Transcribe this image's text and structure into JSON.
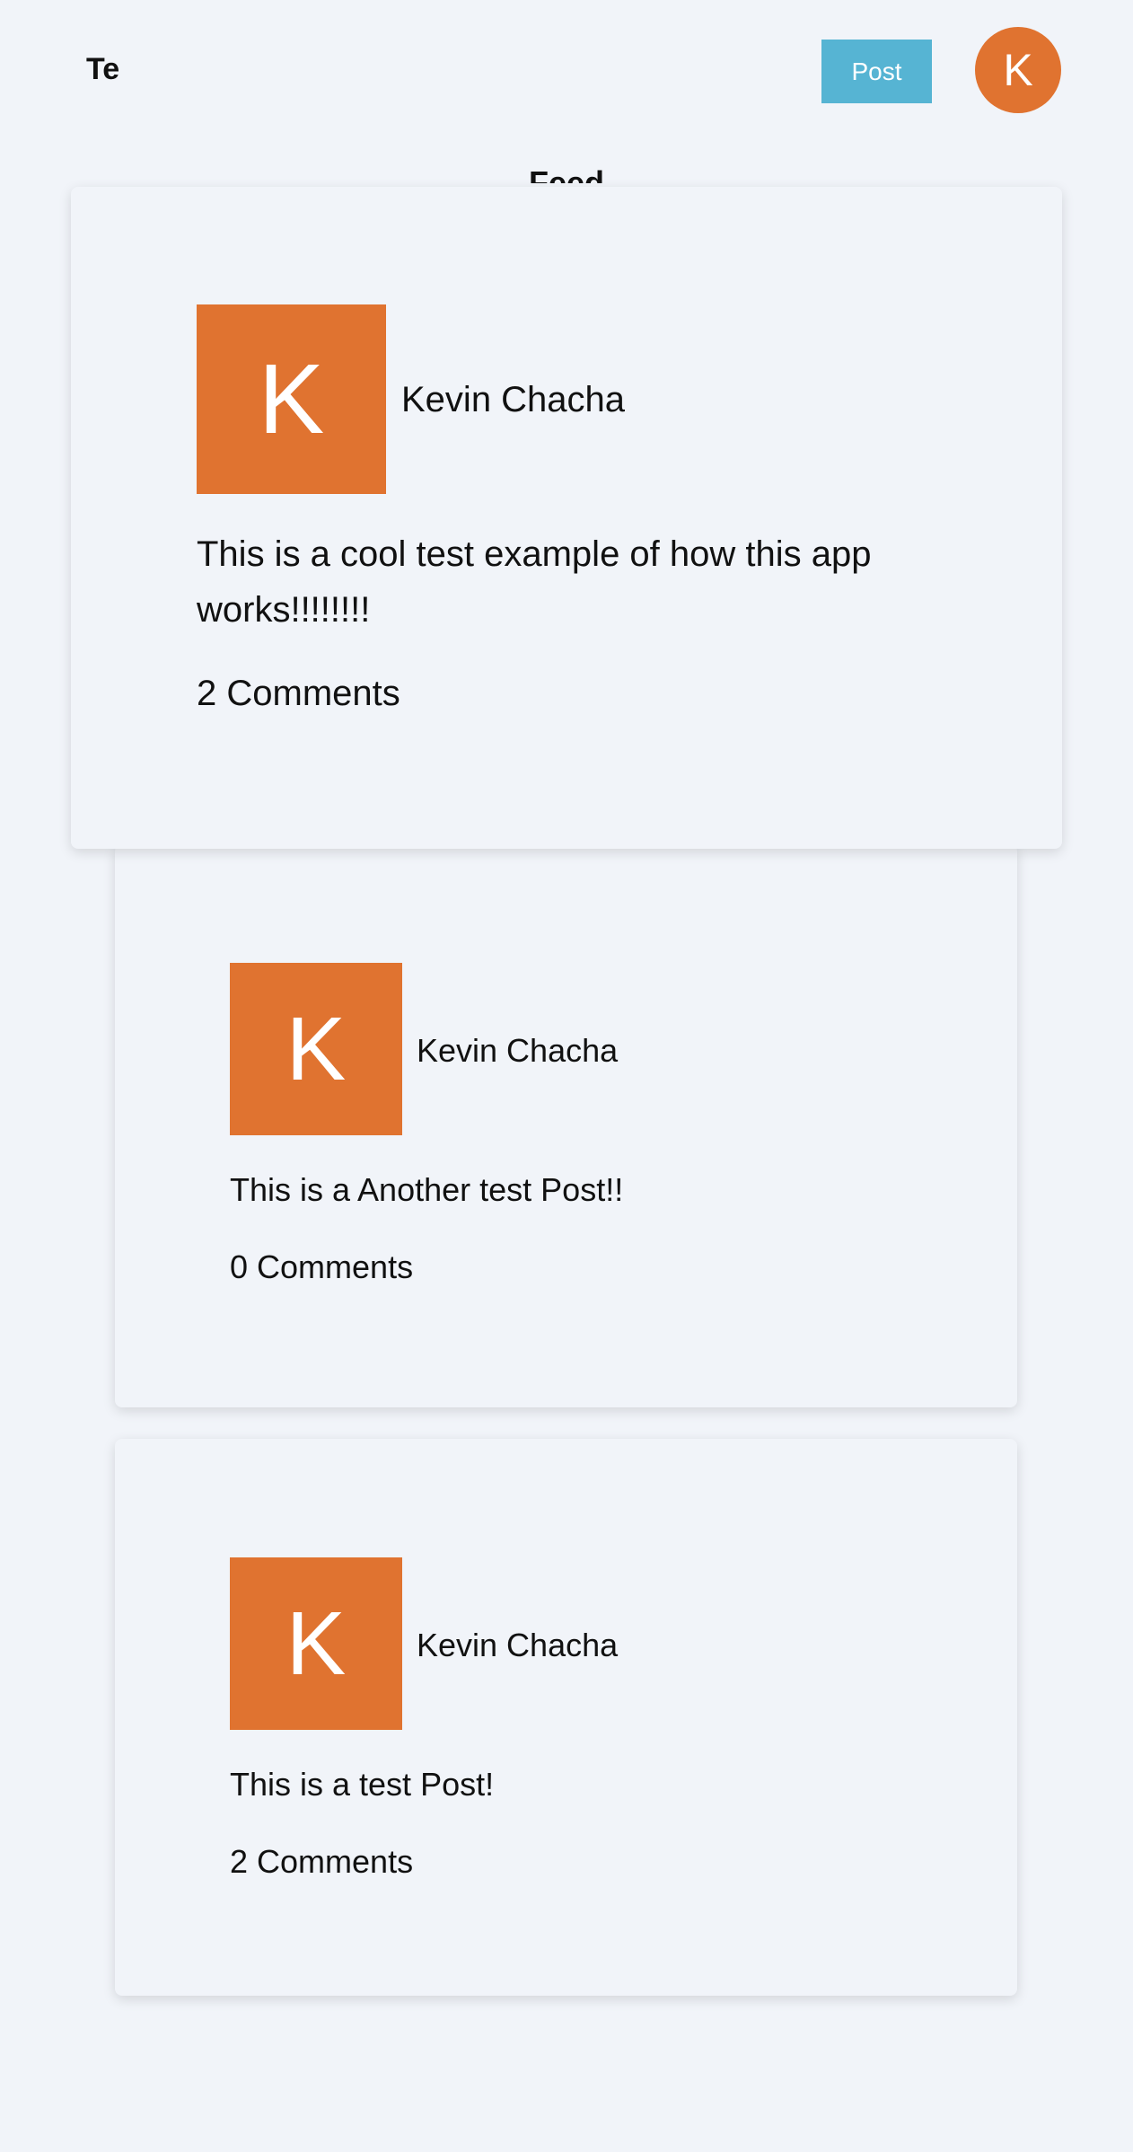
{
  "header": {
    "brand": "Te",
    "post_button_label": "Post",
    "user_avatar_initial": "K"
  },
  "feed": {
    "heading": "Feed"
  },
  "posts": [
    {
      "avatar_initial": "K",
      "author": "Kevin Chacha",
      "text": "This is a cool test example of how this app works!!!!!!!!",
      "comments": "2 Comments"
    },
    {
      "avatar_initial": "K",
      "author": "Kevin Chacha",
      "text": "This is a Another test Post!!",
      "comments": "0 Comments"
    },
    {
      "avatar_initial": "K",
      "author": "Kevin Chacha",
      "text": "This is a test Post!",
      "comments": "2 Comments"
    }
  ],
  "colors": {
    "background": "#f1f4f9",
    "accent_orange": "#e07330",
    "post_button": "#56b4d3"
  }
}
